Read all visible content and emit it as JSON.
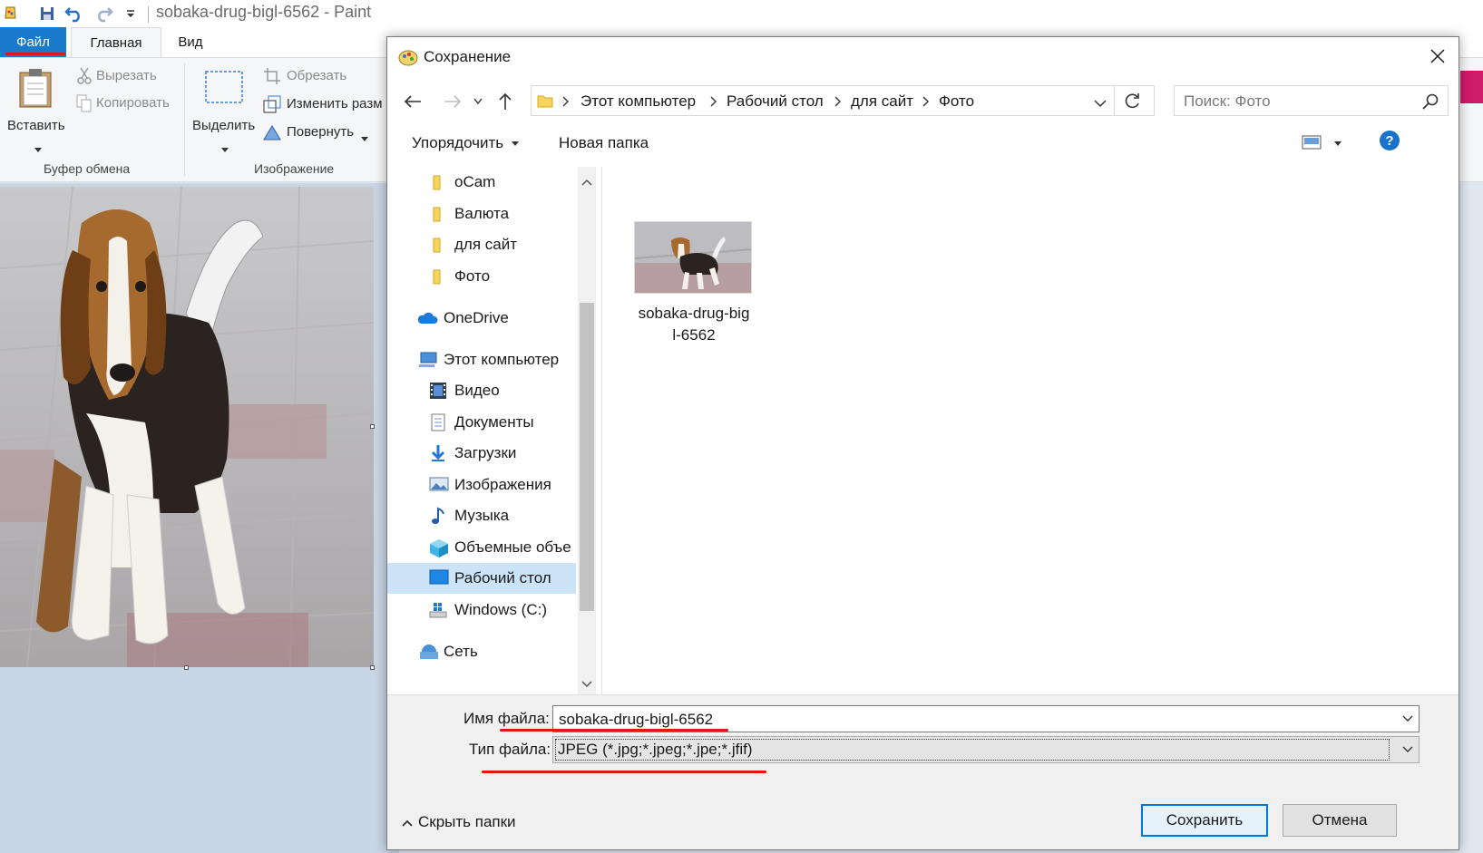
{
  "paint": {
    "window_title": "sobaka-drug-bigl-6562 - Paint",
    "tabs": {
      "file": "Файл",
      "home": "Главная",
      "view": "Вид"
    },
    "ribbon": {
      "paste": "Вставить",
      "cut": "Вырезать",
      "copy": "Копировать",
      "clipboard_group": "Буфер обмена",
      "select": "Выделить",
      "crop": "Обрезать",
      "resize": "Изменить разм",
      "rotate": "Повернуть",
      "image_group": "Изображение"
    }
  },
  "dialog": {
    "title": "Сохранение",
    "address": {
      "crumbs": [
        "Этот компьютер",
        "Рабочий стол",
        "для сайт",
        "Фото"
      ]
    },
    "search": {
      "placeholder": "Поиск: Фото"
    },
    "toolbar": {
      "organize": "Упорядочить",
      "new_folder": "Новая папка"
    },
    "nav_items": [
      {
        "label": "oCam",
        "icon": "folder-icon"
      },
      {
        "label": "Валюта",
        "icon": "folder-icon"
      },
      {
        "label": "для сайт",
        "icon": "folder-icon"
      },
      {
        "label": "Фото",
        "icon": "folder-icon"
      },
      {
        "label": "OneDrive",
        "icon": "cloud-icon"
      },
      {
        "label": "Этот компьютер",
        "icon": "computer-icon"
      },
      {
        "label": "Видео",
        "icon": "video-icon"
      },
      {
        "label": "Документы",
        "icon": "documents-icon"
      },
      {
        "label": "Загрузки",
        "icon": "downloads-icon"
      },
      {
        "label": "Изображения",
        "icon": "pictures-icon"
      },
      {
        "label": "Музыка",
        "icon": "music-icon"
      },
      {
        "label": "Объемные объе",
        "icon": "3d-objects-icon"
      },
      {
        "label": "Рабочий стол",
        "icon": "desktop-icon"
      },
      {
        "label": "Windows  (C:)",
        "icon": "drive-icon"
      },
      {
        "label": "Сеть",
        "icon": "network-icon"
      }
    ],
    "selected_nav": "Рабочий стол",
    "files": [
      {
        "name": "sobaka-drug-bigl-6562",
        "name_lines": [
          "sobaka-drug-big",
          "l-6562"
        ]
      }
    ],
    "filename_label": "Имя файла:",
    "filename_value": "sobaka-drug-bigl-6562",
    "filetype_label": "Тип файла:",
    "filetype_value": "JPEG (*.jpg;*.jpeg;*.jpe;*.jfif)",
    "hide_folders": "Скрыть папки",
    "save_button": "Сохранить",
    "cancel_button": "Отмена"
  },
  "colors": {
    "accent": "#1979ca",
    "highlight": "#e3141b",
    "selection": "#cce4f7",
    "primary_button_border": "#0078d7"
  }
}
